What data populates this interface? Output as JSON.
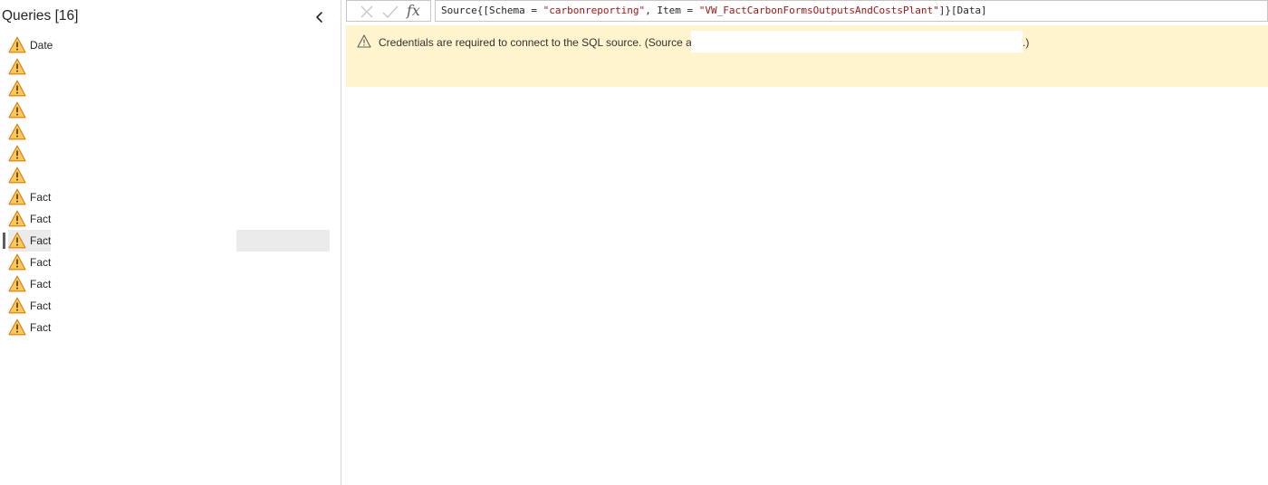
{
  "queries_pane": {
    "title": "Queries [16]",
    "collapse_icon": "chevron-left-icon",
    "items": [
      {
        "label": "Date",
        "icon": "warning-icon",
        "selected": false
      },
      {
        "label": "",
        "icon": "warning-icon",
        "selected": false
      },
      {
        "label": "",
        "icon": "warning-icon",
        "selected": false
      },
      {
        "label": "",
        "icon": "warning-icon",
        "selected": false
      },
      {
        "label": "",
        "icon": "warning-icon",
        "selected": false
      },
      {
        "label": "",
        "icon": "warning-icon",
        "selected": false
      },
      {
        "label": "",
        "icon": "warning-icon",
        "selected": false
      },
      {
        "label": "Fact",
        "icon": "warning-icon",
        "selected": false
      },
      {
        "label": "Fact",
        "icon": "warning-icon",
        "selected": false
      },
      {
        "label": "Fact",
        "icon": "warning-icon",
        "selected": true
      },
      {
        "label": "Fact",
        "icon": "warning-icon",
        "selected": false
      },
      {
        "label": "Fact",
        "icon": "warning-icon",
        "selected": false
      },
      {
        "label": "Fact",
        "icon": "warning-icon",
        "selected": false
      },
      {
        "label": "Fact",
        "icon": "warning-icon",
        "selected": false
      }
    ]
  },
  "formula_bar": {
    "cancel_icon": "close-icon",
    "commit_icon": "checkmark-icon",
    "fx_label": "fx",
    "formula_parts": {
      "p1": "Source{[Schema = ",
      "s1": "\"carbonreporting\"",
      "p2": ", Item = ",
      "s2": "\"VW_FactCarbonFormsOutputsAndCostsPlant\"",
      "p3": "]}[Data]"
    }
  },
  "banner": {
    "icon": "warning-icon",
    "message": "Credentials are required to connect to the SQL source. (Source at",
    "tail": ".)"
  },
  "colors": {
    "banner_bg": "#fff4ce",
    "warning_fill": "#fbc95a",
    "warning_stroke": "#d87d0c",
    "string_literal": "#a31515",
    "selection_bg": "#ebebeb"
  }
}
